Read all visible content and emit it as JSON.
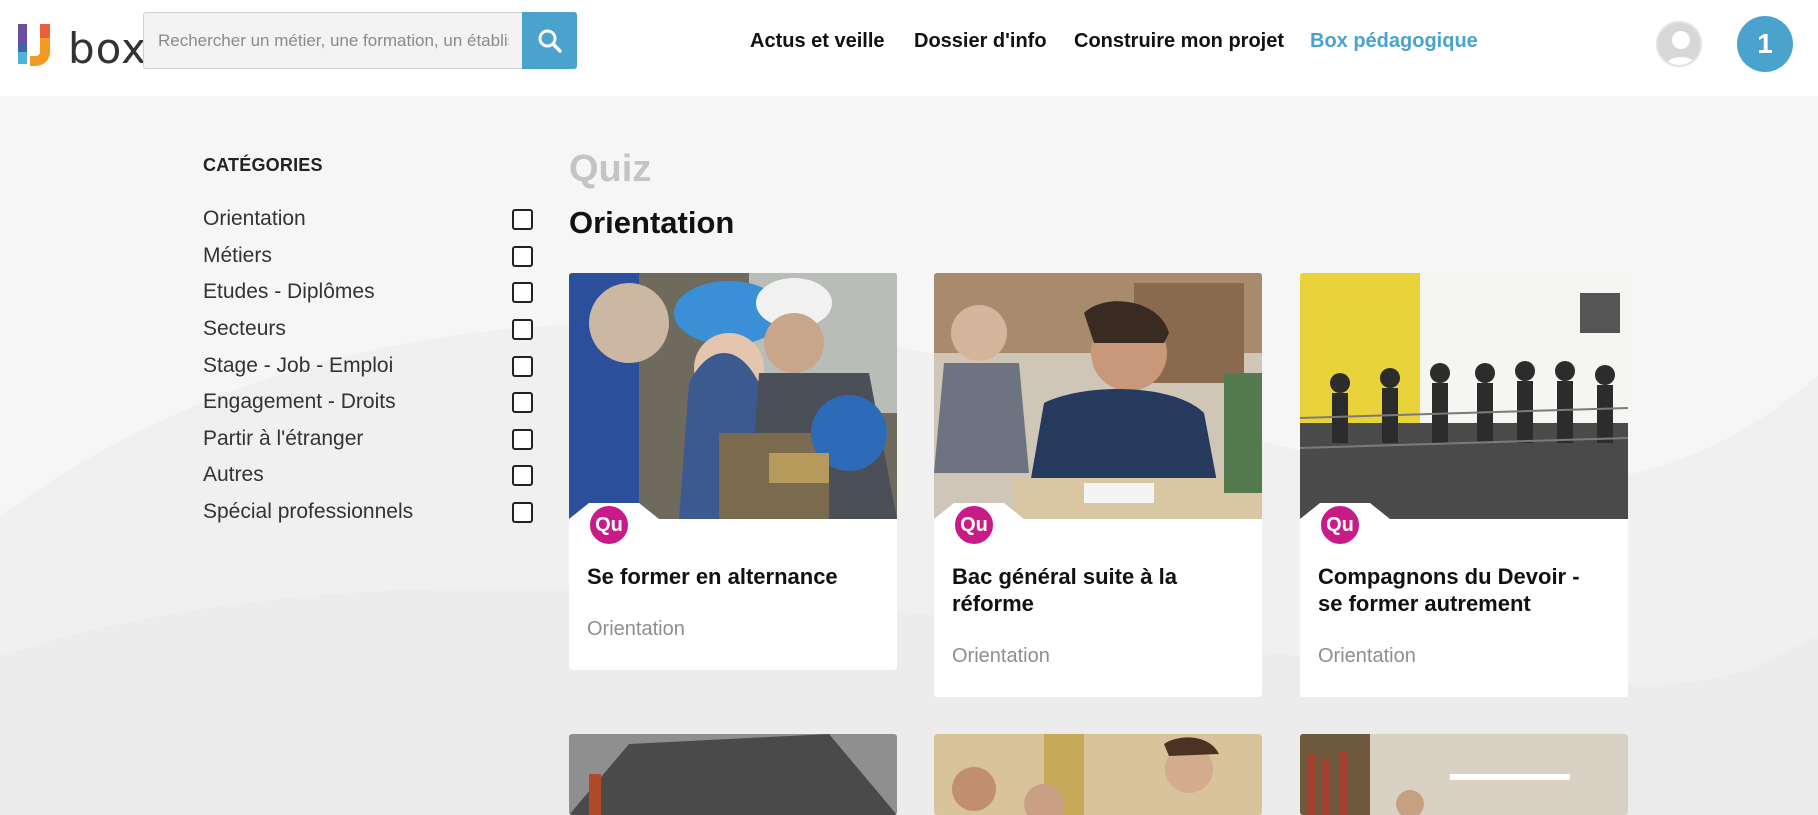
{
  "brand": {
    "logo_text": "box"
  },
  "search": {
    "placeholder": "Rechercher un métier, une formation, un établissement"
  },
  "nav": {
    "items": [
      {
        "label": "Actus et veille"
      },
      {
        "label": "Dossier d'info"
      },
      {
        "label": "Construire mon projet"
      },
      {
        "label": "Box pédagogique"
      }
    ]
  },
  "user": {
    "notification_count": "1"
  },
  "sidebar": {
    "title": "CATÉGORIES",
    "items": [
      {
        "label": "Orientation",
        "checked": false
      },
      {
        "label": "Métiers",
        "checked": false
      },
      {
        "label": "Etudes - Diplômes",
        "checked": false
      },
      {
        "label": "Secteurs",
        "checked": false
      },
      {
        "label": "Stage - Job - Emploi",
        "checked": false
      },
      {
        "label": "Engagement - Droits",
        "checked": false
      },
      {
        "label": "Partir à l'étranger",
        "checked": false
      },
      {
        "label": "Autres",
        "checked": false
      },
      {
        "label": "Spécial professionnels",
        "checked": false
      }
    ]
  },
  "main": {
    "type_label": "Quiz",
    "section_title": "Orientation",
    "cards": [
      {
        "badge": "Qu",
        "title": "Se former en alternance",
        "category": "Orientation"
      },
      {
        "badge": "Qu",
        "title": "Bac général suite à la réforme",
        "category": "Orientation"
      },
      {
        "badge": "Qu",
        "title": "Compagnons du Devoir - se former autrement",
        "category": "Orientation"
      }
    ]
  },
  "colors": {
    "accent": "#4aa3cc",
    "quiz_badge": "#c81b87",
    "muted": "#8e8e8e",
    "heading_muted": "#c4c4c4"
  },
  "icons": {
    "search": "search-icon",
    "avatar": "user-avatar-icon",
    "logo": "ij-logo-icon"
  }
}
